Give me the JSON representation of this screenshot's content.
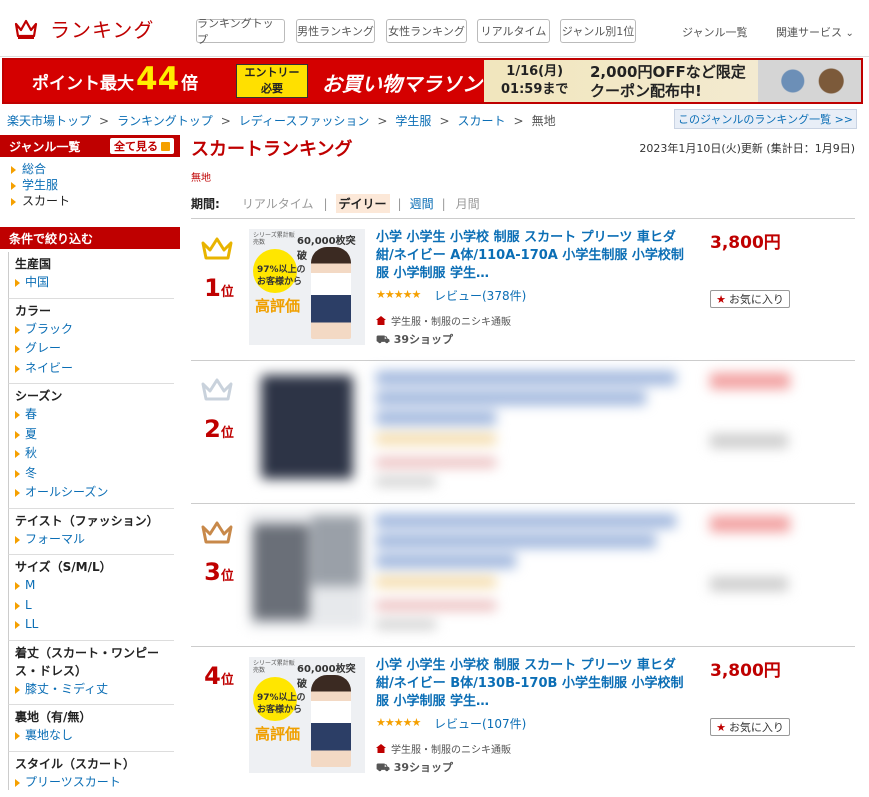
{
  "header": {
    "title": "ランキング",
    "nav": [
      "ランキングトップ",
      "男性ランキング",
      "女性ランキング",
      "リアルタイム",
      "ジャンル別1位"
    ],
    "genre_list": "ジャンル一覧",
    "related": "関連サービス"
  },
  "banner": {
    "point_prefix": "ポイント最大",
    "point_number": "44",
    "point_suffix": "倍",
    "entry_line1": "エントリー",
    "entry_line2": "必要",
    "marathon": "お買い物マラソン",
    "date_line1": "1/16(月)",
    "date_line2": "01:59まで",
    "offer_line1": "2,000円OFFなど限定",
    "offer_line2": "クーポン配布中!"
  },
  "breadcrumb": [
    "楽天市場トップ",
    "ランキングトップ",
    "レディースファッション",
    "学生服",
    "スカート",
    "無地"
  ],
  "genre_ranking_link": "このジャンルのランキング一覧 >>",
  "sidebar": {
    "genre_title": "ジャンル一覧",
    "all_label": "全て見る",
    "genres": [
      "総合",
      "学生服",
      "スカート"
    ],
    "filter_title": "条件で絞り込む",
    "groups": [
      {
        "title": "生産国",
        "options": [
          "中国"
        ]
      },
      {
        "title": "カラー",
        "options": [
          "ブラック",
          "グレー",
          "ネイビー"
        ]
      },
      {
        "title": "シーズン",
        "options": [
          "春",
          "夏",
          "秋",
          "冬",
          "オールシーズン"
        ]
      },
      {
        "title": "テイスト（ファッション）",
        "options": [
          "フォーマル"
        ]
      },
      {
        "title": "サイズ（S/M/L）",
        "options": [
          "M",
          "L",
          "LL"
        ]
      },
      {
        "title": "着丈（スカート・ワンピース・ドレス）",
        "options": [
          "膝丈・ミディ丈"
        ]
      },
      {
        "title": "裏地（有/無）",
        "options": [
          "裏地なし"
        ]
      },
      {
        "title": "スタイル（スカート）",
        "options": [
          "プリーツスカート"
        ]
      }
    ]
  },
  "main": {
    "title": "スカートランキング",
    "subtag": "無地",
    "updated": "2023年1月10日(火)更新 (集計日：1月9日)",
    "period_label": "期間:",
    "periods": [
      "リアルタイム",
      "デイリー",
      "週間",
      "月間"
    ],
    "items": [
      {
        "rank": "1",
        "rank_unit": "位",
        "title": "小学 小学生 小学校 制服 スカート プリーツ 車ヒダ 紺/ネイビー A体/110A-170A 小学生制服 小学校制服 小学制服 学生…",
        "price": "3,800円",
        "stars": "★★★★★",
        "review": "レビュー(378件)",
        "fav": "お気に入り",
        "shop": "学生服・制服のニシキ通販",
        "ship": "39ショップ",
        "thumb_badge": "60,000枚突破",
        "thumb_badge_small": "シリーズ累計販売数",
        "thumb_pct": "97%以上の",
        "thumb_pct2": "お客様から",
        "thumb_eval": "高評価"
      },
      {
        "rank": "2",
        "rank_unit": "位"
      },
      {
        "rank": "3",
        "rank_unit": "位"
      },
      {
        "rank": "4",
        "rank_unit": "位",
        "title": "小学 小学生 小学校 制服 スカート プリーツ 車ヒダ 紺/ネイビー B体/130B-170B 小学生制服 小学校制服 小学制服 学生…",
        "price": "3,800円",
        "stars": "★★★★★",
        "review": "レビュー(107件)",
        "fav": "お気に入り",
        "shop": "学生服・制服のニシキ通販",
        "ship": "39ショップ",
        "thumb_badge": "60,000枚突破",
        "thumb_badge_small": "シリーズ累計販売数",
        "thumb_pct": "97%以上の",
        "thumb_pct2": "お客様から",
        "thumb_eval": "高評価"
      }
    ]
  },
  "colors": {
    "brand": "#bf0000",
    "link": "#0b6eb5",
    "star": "#f5a000",
    "gold": "#e8b400",
    "silver": "#c9d2dc",
    "bronze": "#c8894a"
  }
}
